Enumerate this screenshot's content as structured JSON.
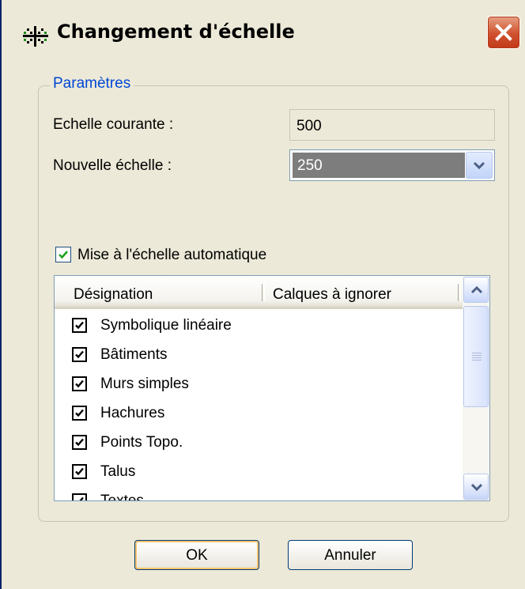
{
  "window": {
    "title": "Changement d'échelle",
    "icon": "grid-crosshair-icon",
    "close_icon": "close-icon"
  },
  "group": {
    "legend": "Paramètres",
    "current_scale_label": "Echelle courante :",
    "current_scale_value": "500",
    "new_scale_label": "Nouvelle échelle :",
    "new_scale_value": "250",
    "auto_scale_label": "Mise à l'échelle automatique",
    "auto_scale_checked": true
  },
  "list": {
    "columns": [
      "Désignation",
      "Calques à ignorer"
    ],
    "rows": [
      {
        "label": "Symbolique linéaire",
        "checked": true
      },
      {
        "label": "Bâtiments",
        "checked": true
      },
      {
        "label": "Murs simples",
        "checked": true
      },
      {
        "label": "Hachures",
        "checked": true
      },
      {
        "label": "Points Topo.",
        "checked": true
      },
      {
        "label": "Talus",
        "checked": true
      },
      {
        "label": "Textes",
        "checked": true
      }
    ]
  },
  "buttons": {
    "ok": "OK",
    "cancel": "Annuler"
  },
  "colors": {
    "accent": "#0046d5",
    "close": "#d0502d"
  }
}
